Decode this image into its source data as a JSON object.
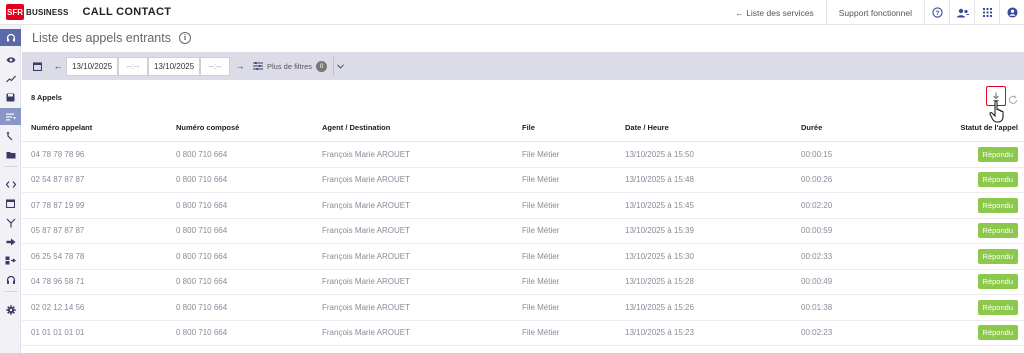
{
  "brand": {
    "logo_text": "SFR",
    "business": "BUSINESS",
    "app_title": "CALL CONTACT"
  },
  "topnav": {
    "services_link": "← Liste des services",
    "support_link": "Support fonctionnel",
    "icons": [
      "help-icon",
      "users-icon",
      "apps-grid-icon",
      "account-icon"
    ]
  },
  "sidebar": {
    "items": [
      "headset-icon",
      "eye-icon",
      "trend-icon",
      "save-icon",
      "list-filter-icon",
      "call-split-icon",
      "folder-icon",
      "code-icon",
      "calendar-icon",
      "merge-icon",
      "forward-icon",
      "transfer-icon",
      "headphones-icon",
      "settings-icon"
    ]
  },
  "page": {
    "title": "Liste des appels entrants"
  },
  "filters": {
    "date_from": "13/10/2025",
    "time_from": "--:--",
    "date_to": "13/10/2025",
    "time_to": "--:--",
    "more_filters": "Plus de filtres",
    "more_filters_count": "0"
  },
  "results": {
    "count_label": "8 Appels"
  },
  "table": {
    "columns": {
      "caller": "Numéro appelant",
      "dialed": "Numéro composé",
      "agent": "Agent / Destination",
      "queue": "File",
      "datetime": "Date / Heure",
      "duration": "Durée",
      "status": "Statut de l'appel"
    },
    "rows": [
      {
        "caller": "04 78 78 78 96",
        "dialed": "0 800 710 664",
        "agent": "François Marie AROUET",
        "queue": "File Métier",
        "datetime": "13/10/2025 à 15:50",
        "duration": "00:00:15",
        "status": "Répondu"
      },
      {
        "caller": "02 54 87 87 87",
        "dialed": "0 800 710 664",
        "agent": "François Marie AROUET",
        "queue": "File Métier",
        "datetime": "13/10/2025 à 15:48",
        "duration": "00:00:26",
        "status": "Répondu"
      },
      {
        "caller": "07 78 87 19 99",
        "dialed": "0 800 710 664",
        "agent": "François Marie AROUET",
        "queue": "File Métier",
        "datetime": "13/10/2025 à 15:45",
        "duration": "00:02:20",
        "status": "Répondu"
      },
      {
        "caller": "05 87 87 87 87",
        "dialed": "0 800 710 664",
        "agent": "François Marie AROUET",
        "queue": "File Métier",
        "datetime": "13/10/2025 à 15:39",
        "duration": "00:00:59",
        "status": "Répondu"
      },
      {
        "caller": "06 25 54 78 78",
        "dialed": "0 800 710 664",
        "agent": "François Marie AROUET",
        "queue": "File Métier",
        "datetime": "13/10/2025 à 15:30",
        "duration": "00:02:33",
        "status": "Répondu"
      },
      {
        "caller": "04 78 96 58 71",
        "dialed": "0 800 710 664",
        "agent": "François Marie AROUET",
        "queue": "File Métier",
        "datetime": "13/10/2025 à 15:28",
        "duration": "00:00:49",
        "status": "Répondu"
      },
      {
        "caller": "02 02 12 14 56",
        "dialed": "0 800 710 664",
        "agent": "François Marie AROUET",
        "queue": "File Métier",
        "datetime": "13/10/2025 à 15:26",
        "duration": "00:01:38",
        "status": "Répondu"
      },
      {
        "caller": "01 01 01 01 01",
        "dialed": "0 800 710 664",
        "agent": "François Marie AROUET",
        "queue": "File Métier",
        "datetime": "13/10/2025 à 15:23",
        "duration": "00:02:23",
        "status": "Répondu"
      }
    ]
  },
  "colors": {
    "brand_red": "#e2001a",
    "accent": "#5a6aa8",
    "status_answered": "#8cc84b",
    "filter_bar": "#dcdce8"
  }
}
